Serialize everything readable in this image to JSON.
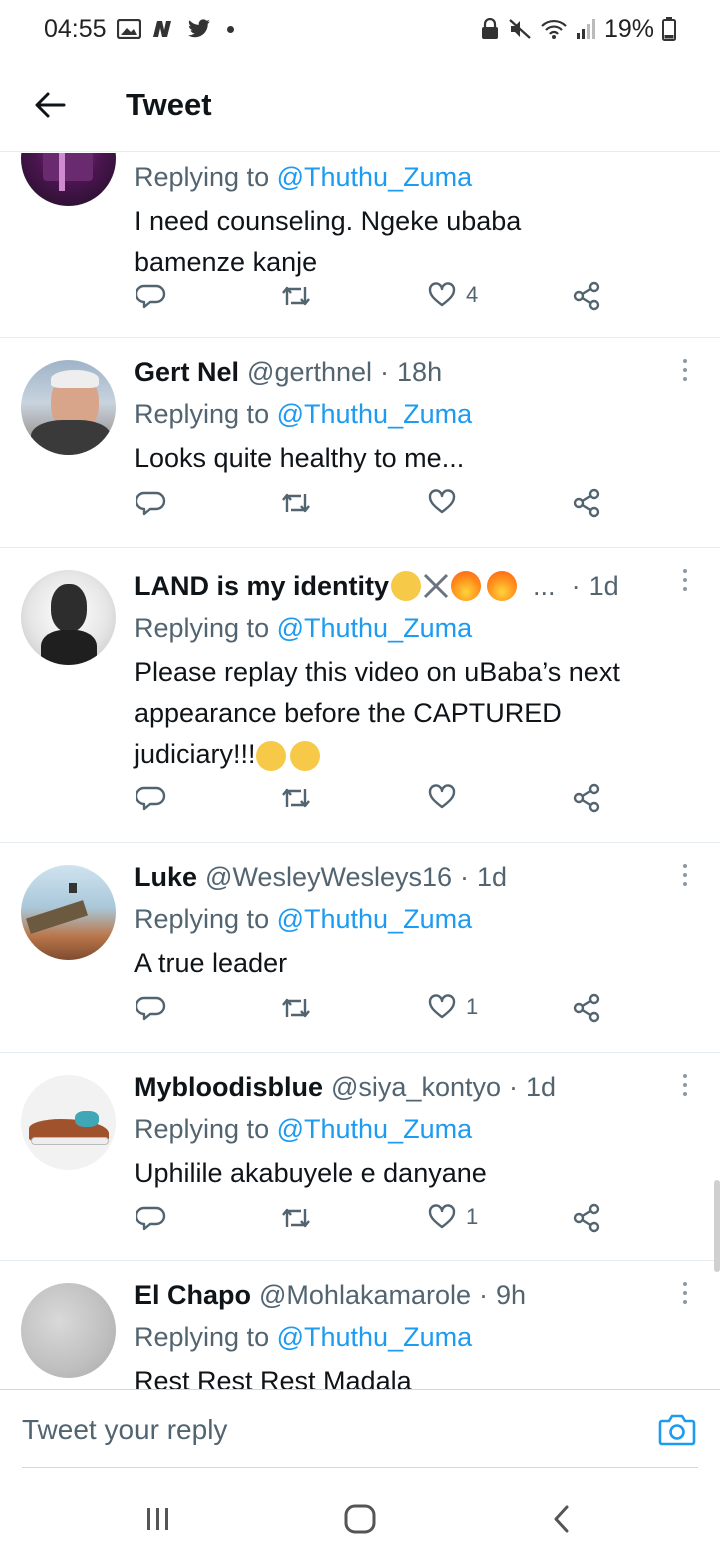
{
  "status_bar": {
    "time": "04:55",
    "battery": "19%",
    "icons": [
      "gallery-icon",
      "news-icon",
      "twitter-icon",
      "dot-icon",
      "lock-icon",
      "mute-icon",
      "wifi-icon",
      "signal-icon",
      "battery-icon"
    ]
  },
  "header": {
    "title": "Tweet",
    "back_icon": "arrow-left-icon"
  },
  "tweets": [
    {
      "name": "",
      "handle": "",
      "time": "",
      "replying_label": "Replying to",
      "replying_handle": "@Thuthu_Zuma",
      "text": "I need counseling. Ngeke ubaba bamenze kanje",
      "like_count": "4",
      "has_more_menu": false
    },
    {
      "name": "Gert Nel",
      "handle": "@gerthnel",
      "sep": "·",
      "time": "18h",
      "replying_label": "Replying to",
      "replying_handle": "@Thuthu_Zuma",
      "text": "Looks quite healthy to me...",
      "like_count": ""
    },
    {
      "name": "LAND is my identity",
      "handle": "...",
      "sep": "·",
      "time": "1d",
      "replying_label": "Replying to",
      "replying_handle": "@Thuthu_Zuma",
      "text": "Please replay this video on uBaba’s next appearance before the CAPTURED judiciary!!!",
      "like_count": "",
      "name_emojis": [
        "raised-fist-emoji",
        "crossed-swords-emoji",
        "fire-emoji",
        "fire-emoji"
      ],
      "text_emojis": [
        "crying-face-emoji",
        "crying-face-emoji"
      ]
    },
    {
      "name": "Luke",
      "handle": "@WesleyWesleys16",
      "sep": "·",
      "time": "1d",
      "replying_label": "Replying to",
      "replying_handle": "@Thuthu_Zuma",
      "text": "A true leader",
      "like_count": "1"
    },
    {
      "name": "Mybloodisblue",
      "handle": "@siya_kontyo",
      "sep": "·",
      "time": "1d",
      "replying_label": "Replying to",
      "replying_handle": "@Thuthu_Zuma",
      "text": "Uphilile akabuyele e danyane",
      "like_count": "1"
    },
    {
      "name": "El Chapo",
      "handle": "@Mohlakamarole",
      "sep": "·",
      "time": "9h",
      "replying_label": "Replying to",
      "replying_handle": "@Thuthu_Zuma",
      "text": "Rest Rest Rest Madala",
      "like_count": ""
    }
  ],
  "reply_bar": {
    "placeholder": "Tweet your reply",
    "camera_icon": "camera-icon"
  },
  "nav": {
    "icons": [
      "recent-apps-icon",
      "home-icon",
      "back-icon"
    ]
  },
  "colors": {
    "accent": "#1d9bf0",
    "text": "#0f1419",
    "muted": "#536471",
    "divider": "#e6ecf0"
  }
}
